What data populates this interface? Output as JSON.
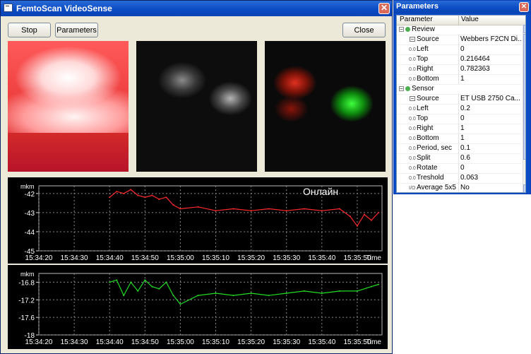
{
  "main_window": {
    "title": "FemtoScan VideoSense",
    "buttons": {
      "stop": "Stop",
      "parameters": "Parameters",
      "close": "Close"
    },
    "status_overlay": "Онлайн"
  },
  "colors": {
    "titlebar": "#0b4cc4",
    "trace1": "#ff2a2a",
    "trace2": "#22dd22",
    "chart_bg": "#000000"
  },
  "charts": [
    {
      "unit": "mkm",
      "y_ticks": [
        "-42",
        "-43",
        "-44",
        "-45"
      ],
      "x_ticks": [
        "15:34:20",
        "15:34:30",
        "15:34:40",
        "15:34:50",
        "15:35:00",
        "15:35:10",
        "15:35:20",
        "15:35:30",
        "15:35:40",
        "15:35:50"
      ],
      "x_label": "Time"
    },
    {
      "unit": "mkm",
      "y_ticks": [
        "-16.8",
        "-17.2",
        "-17.6",
        "-18"
      ],
      "x_ticks": [
        "15:34:20",
        "15:34:30",
        "15:34:40",
        "15:34:50",
        "15:35:00",
        "15:35:10",
        "15:35:20",
        "15:35:30",
        "15:35:40",
        "15:35:50"
      ],
      "x_label": "Time"
    }
  ],
  "chart_data": [
    {
      "type": "line",
      "ylabel": "mkm",
      "xlabel": "Time",
      "ylim": [
        -45,
        -41.6
      ],
      "x_range": [
        "15:34:20",
        "15:35:57"
      ],
      "series": [
        {
          "color": "#ff2a2a",
          "x": [
            "15:34:40",
            "15:34:42",
            "15:34:44",
            "15:34:46",
            "15:34:48",
            "15:34:50",
            "15:34:52",
            "15:34:54",
            "15:34:56",
            "15:34:58",
            "15:35:00",
            "15:35:05",
            "15:35:10",
            "15:35:15",
            "15:35:20",
            "15:35:25",
            "15:35:30",
            "15:35:35",
            "15:35:40",
            "15:35:45",
            "15:35:48",
            "15:35:50",
            "15:35:52",
            "15:35:54",
            "15:35:56"
          ],
          "values": [
            -42.2,
            -41.9,
            -42.0,
            -41.8,
            -42.1,
            -42.2,
            -42.1,
            -42.3,
            -42.2,
            -42.6,
            -42.8,
            -42.7,
            -42.9,
            -42.8,
            -42.9,
            -42.8,
            -42.9,
            -42.8,
            -42.9,
            -42.8,
            -43.2,
            -43.7,
            -43.1,
            -43.4,
            -43.0
          ]
        }
      ]
    },
    {
      "type": "line",
      "ylabel": "mkm",
      "xlabel": "Time",
      "ylim": [
        -18,
        -16.6
      ],
      "x_range": [
        "15:34:20",
        "15:35:57"
      ],
      "series": [
        {
          "color": "#22dd22",
          "x": [
            "15:34:40",
            "15:34:42",
            "15:34:44",
            "15:34:46",
            "15:34:48",
            "15:34:50",
            "15:34:52",
            "15:34:54",
            "15:34:56",
            "15:34:58",
            "15:35:00",
            "15:35:05",
            "15:35:10",
            "15:35:15",
            "15:35:20",
            "15:35:25",
            "15:35:30",
            "15:35:35",
            "15:35:40",
            "15:35:45",
            "15:35:50",
            "15:35:54",
            "15:35:56"
          ],
          "values": [
            -16.8,
            -16.75,
            -17.1,
            -16.8,
            -17.0,
            -16.75,
            -16.9,
            -16.95,
            -16.8,
            -17.1,
            -17.3,
            -17.1,
            -17.05,
            -17.1,
            -17.05,
            -17.1,
            -17.05,
            -17.0,
            -17.05,
            -17.0,
            -17.0,
            -16.9,
            -16.85
          ]
        }
      ]
    }
  ],
  "parameters_window": {
    "title": "Parameters",
    "header": {
      "parameter": "Parameter",
      "value": "Value"
    },
    "rows": [
      {
        "type": "group",
        "name": "Review",
        "toggle": "−"
      },
      {
        "type": "item",
        "icon": "picker-icon",
        "name": "Source",
        "value": "Webbers F2CN Di..."
      },
      {
        "type": "item",
        "icon": "numeric-icon",
        "icon_text": "0.0",
        "name": "Left",
        "value": "0"
      },
      {
        "type": "item",
        "icon": "numeric-icon",
        "icon_text": "0.0",
        "name": "Top",
        "value": "0.216464"
      },
      {
        "type": "item",
        "icon": "numeric-icon",
        "icon_text": "0.0",
        "name": "Right",
        "value": "0.782363"
      },
      {
        "type": "item",
        "icon": "numeric-icon",
        "icon_text": "0.0",
        "name": "Bottom",
        "value": "1"
      },
      {
        "type": "group",
        "name": "Sensor",
        "toggle": "−"
      },
      {
        "type": "item",
        "icon": "picker-icon",
        "name": "Source",
        "value": "ET USB 2750 Ca..."
      },
      {
        "type": "item",
        "icon": "numeric-icon",
        "icon_text": "0.0",
        "name": "Left",
        "value": "0.2"
      },
      {
        "type": "item",
        "icon": "numeric-icon",
        "icon_text": "0.0",
        "name": "Top",
        "value": "0"
      },
      {
        "type": "item",
        "icon": "numeric-icon",
        "icon_text": "0.0",
        "name": "Right",
        "value": "1"
      },
      {
        "type": "item",
        "icon": "numeric-icon",
        "icon_text": "0.0",
        "name": "Bottom",
        "value": "1"
      },
      {
        "type": "item",
        "icon": "numeric-icon",
        "icon_text": "0.0",
        "name": "Period, sec",
        "value": "0.1"
      },
      {
        "type": "item",
        "icon": "numeric-icon",
        "icon_text": "0.0",
        "name": "Split",
        "value": "0.6"
      },
      {
        "type": "item",
        "icon": "numeric-icon",
        "icon_text": "0.0",
        "name": "Rotate",
        "value": "0"
      },
      {
        "type": "item",
        "icon": "numeric-icon",
        "icon_text": "0.0",
        "name": "Treshold",
        "value": "0.063"
      },
      {
        "type": "item",
        "icon": "boolean-icon",
        "icon_text": "I/O",
        "name": "Average 5x5",
        "value": "No"
      }
    ]
  }
}
